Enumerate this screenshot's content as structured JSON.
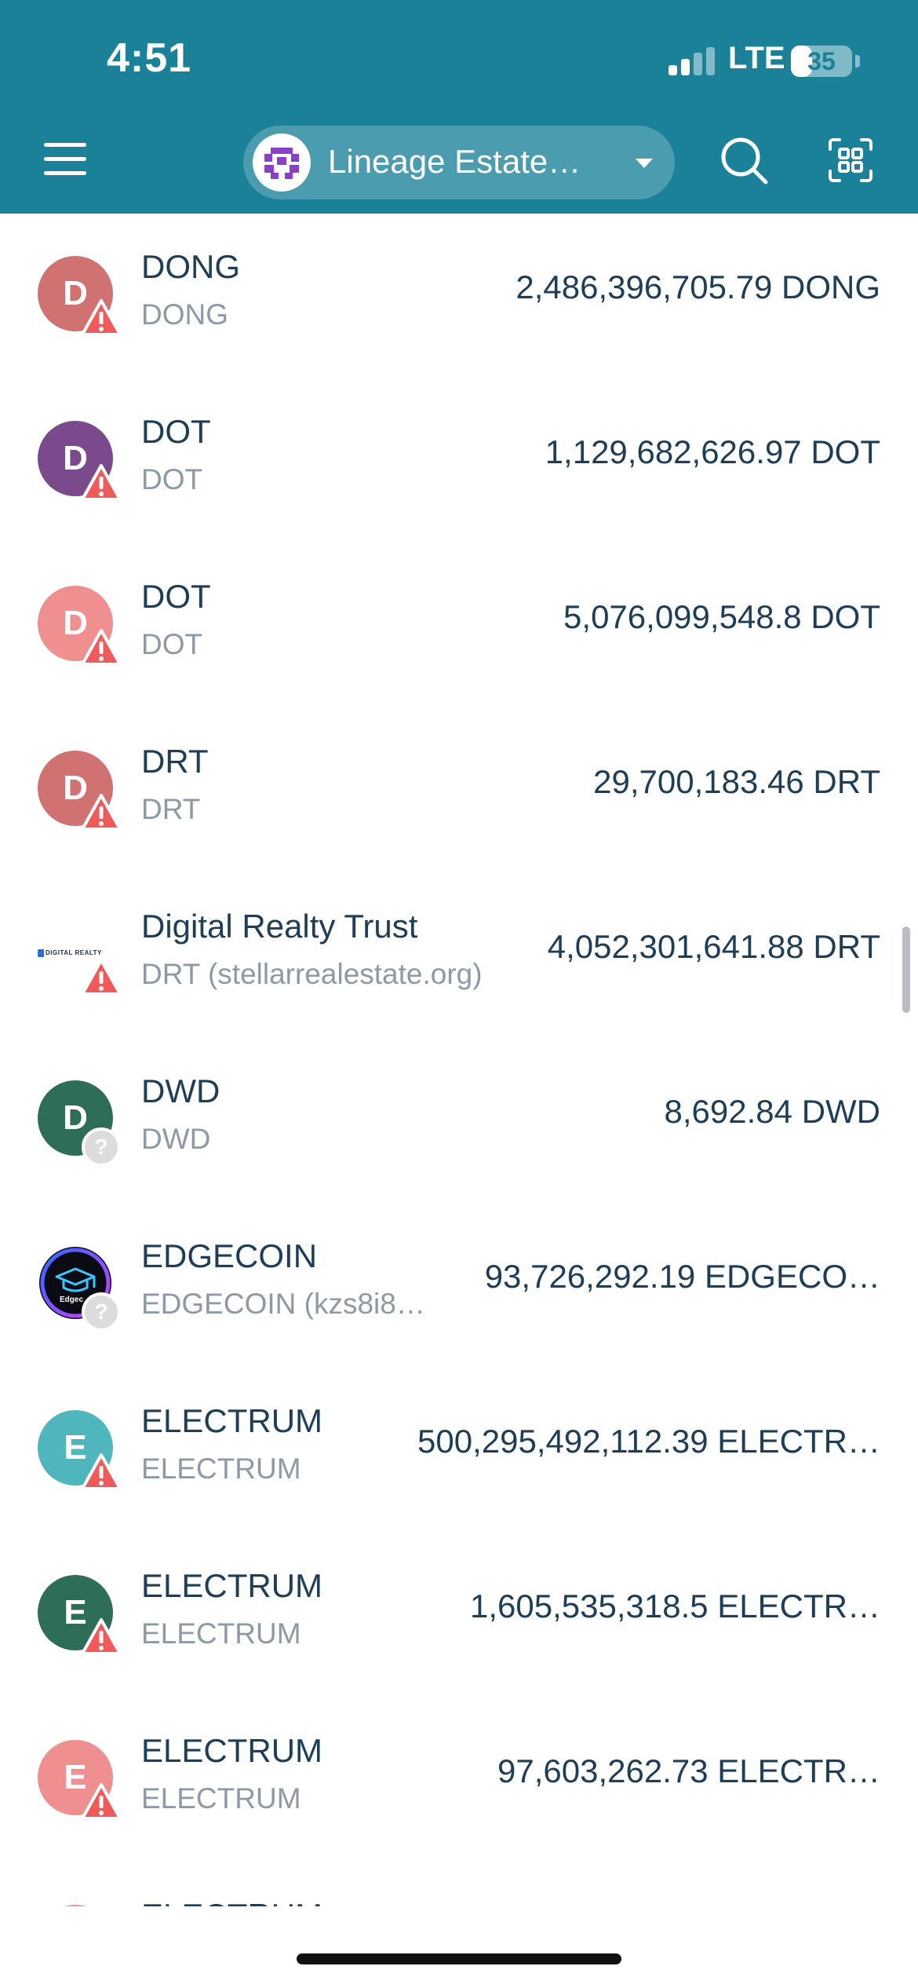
{
  "status_bar": {
    "time": "4:51",
    "network": "LTE",
    "battery": "35",
    "battery_level": 0.35
  },
  "header": {
    "account_name": "Lineage Estate…",
    "menu_icon": "hamburger-menu-icon",
    "search_icon": "search-icon",
    "scan_icon": "qr-scan-icon"
  },
  "colors": {
    "header_bg": "#1a8199",
    "text_primary": "#1e3d57",
    "text_secondary": "#8d9aa5",
    "warning": "#f05a5a"
  },
  "tokens": [
    {
      "name": "DONG",
      "code": "DONG",
      "balance": "2,486,396,705.79 DONG",
      "initial": "D",
      "color": "#d07272",
      "badge": "warning"
    },
    {
      "name": "DOT",
      "code": "DOT",
      "balance": "1,129,682,626.97 DOT",
      "initial": "D",
      "color": "#7a4a8c",
      "badge": "warning"
    },
    {
      "name": "DOT",
      "code": "DOT",
      "balance": "5,076,099,548.8 DOT",
      "initial": "D",
      "color": "#ef8f8f",
      "badge": "warning"
    },
    {
      "name": "DRT",
      "code": "DRT",
      "balance": "29,700,183.46 DRT",
      "initial": "D",
      "color": "#d07272",
      "badge": "warning"
    },
    {
      "name": "Digital Realty Trust",
      "code": "DRT (stellarrealestate.org)",
      "balance": "4,052,301,641.88 DRT",
      "logo": "digital-realty-logo",
      "logo_text": "DIGITAL REALTY",
      "badge": "warning"
    },
    {
      "name": "DWD",
      "code": "DWD",
      "balance": "8,692.84 DWD",
      "initial": "D",
      "color": "#2e6e58",
      "badge": "unknown"
    },
    {
      "name": "EDGECOIN",
      "code": "EDGECOIN (kzs8i8…",
      "balance": "93,726,292.19 EDGECO…",
      "logo": "edgecoin-logo",
      "logo_text": "Edgec",
      "badge": "unknown"
    },
    {
      "name": "ELECTRUM",
      "code": "ELECTRUM",
      "balance": "500,295,492,112.39 ELECTR…",
      "initial": "E",
      "color": "#4fb6bd",
      "badge": "warning"
    },
    {
      "name": "ELECTRUM",
      "code": "ELECTRUM",
      "balance": "1,605,535,318.5 ELECTR…",
      "initial": "E",
      "color": "#2e6e58",
      "badge": "warning"
    },
    {
      "name": "ELECTRUM",
      "code": "ELECTRUM",
      "balance": "97,603,262.73 ELECTR…",
      "initial": "E",
      "color": "#ef8f8f",
      "badge": "warning"
    },
    {
      "name": "ELECTRUM",
      "code": "",
      "balance": "",
      "initial": "",
      "color": "#ef8f8f",
      "badge": "none"
    }
  ]
}
